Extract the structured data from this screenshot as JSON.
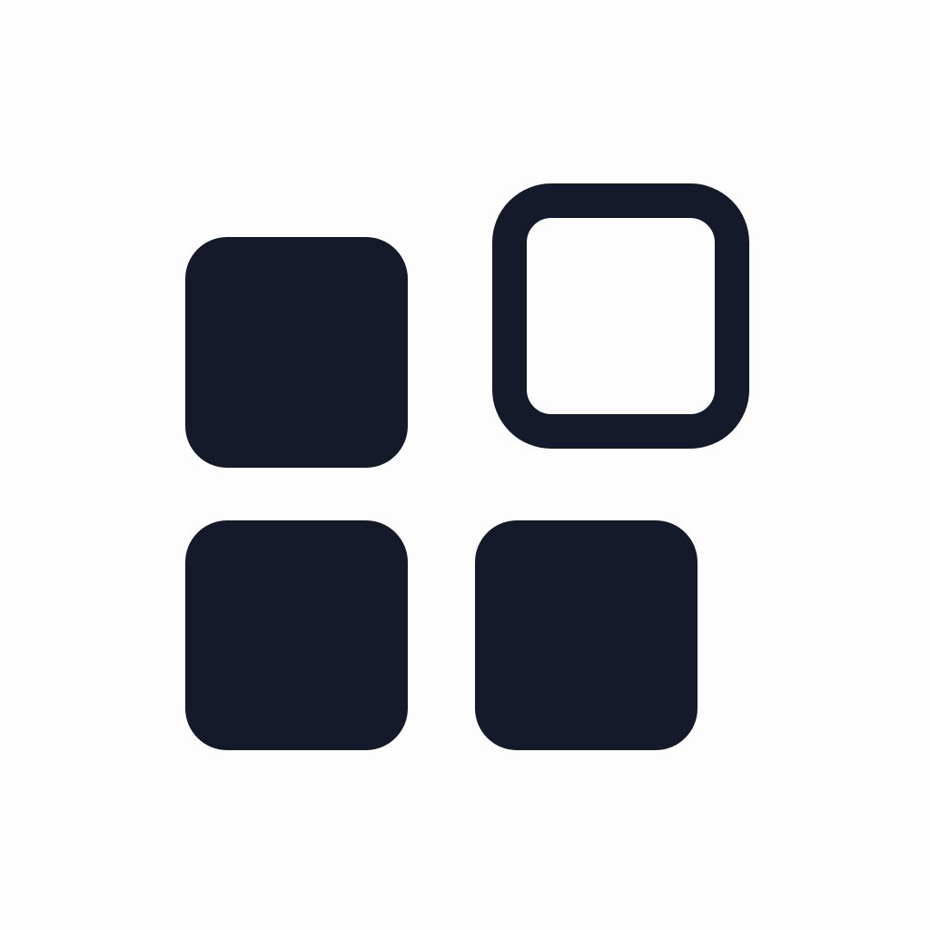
{
  "icon": {
    "name": "apps-add-icon",
    "fill_color": "#141a29",
    "background_color": "#fdfdfd",
    "tiles": [
      {
        "name": "top-left-tile",
        "style": "filled"
      },
      {
        "name": "top-right-tile",
        "style": "outlined"
      },
      {
        "name": "bottom-left-tile",
        "style": "filled"
      },
      {
        "name": "bottom-right-tile",
        "style": "filled"
      }
    ]
  }
}
